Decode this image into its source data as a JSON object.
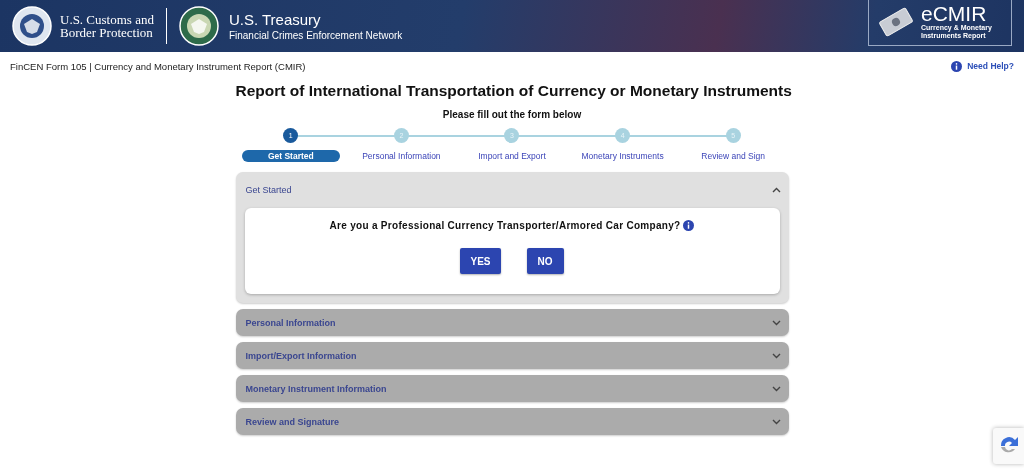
{
  "header": {
    "cbp_lines": [
      "U.S. Customs and",
      "Border Protection"
    ],
    "treasury_title": "U.S. Treasury",
    "treasury_subtitle": "Financial Crimes Enforcement Network",
    "product_name": "eCMIR",
    "product_tagline": "Currency & Monetary Instruments Report"
  },
  "subheader": {
    "form_title": "FinCEN Form 105 | Currency and Monetary Instrument Report (CMIR)",
    "help_link": "Need Help?"
  },
  "page_title": "Report of International Transportation of Currency or Monetary Instruments",
  "instructions": "Please fill out the form below",
  "steps": [
    {
      "number": "1",
      "label": "Get Started",
      "selected": true
    },
    {
      "number": "2",
      "label": "Personal Information",
      "selected": false
    },
    {
      "number": "3",
      "label": "Import and Export",
      "selected": false
    },
    {
      "number": "4",
      "label": "Monetary Instruments",
      "selected": false
    },
    {
      "number": "5",
      "label": "Review and Sign",
      "selected": false
    }
  ],
  "sections": [
    {
      "title": "Get Started",
      "expanded": true,
      "question": "Are you a Professional Currency Transporter/Armored Car Company?",
      "buttons": [
        "YES",
        "NO"
      ]
    },
    {
      "title": "Personal Information",
      "expanded": false
    },
    {
      "title": "Import/Export Information",
      "expanded": false
    },
    {
      "title": "Monetary Instrument Information",
      "expanded": false
    },
    {
      "title": "Review and Signature",
      "expanded": false
    }
  ]
}
